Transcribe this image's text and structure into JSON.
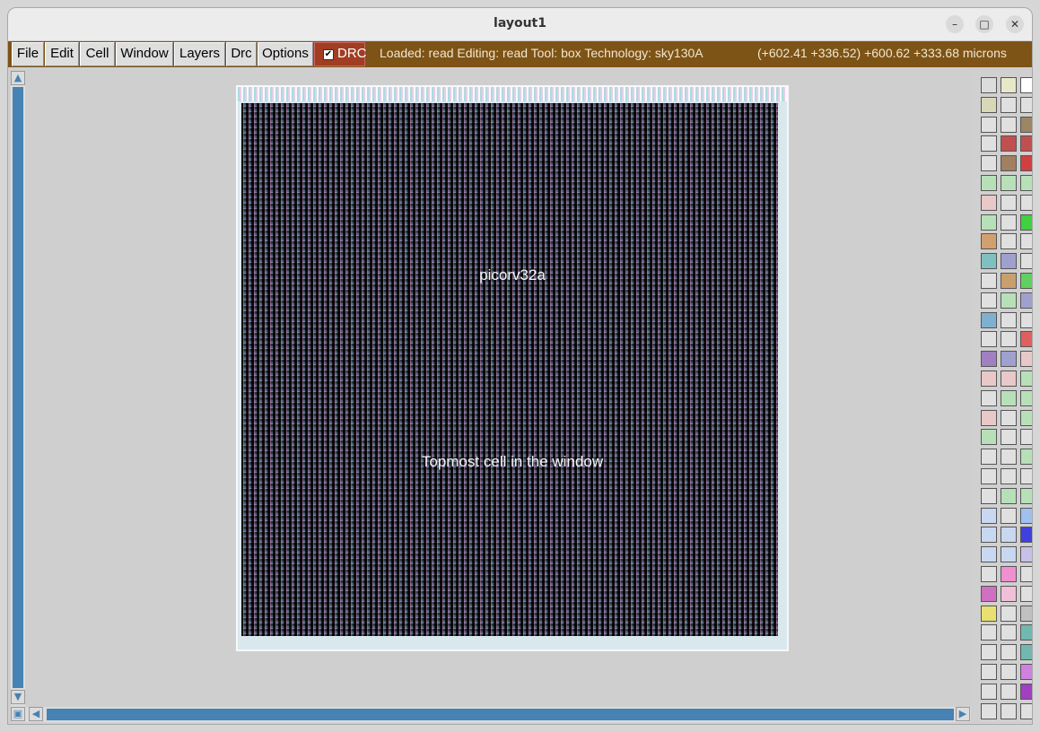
{
  "window": {
    "title": "layout1",
    "minimize": "–",
    "maximize": "□",
    "close": "✕"
  },
  "menu": {
    "items": [
      {
        "id": "file",
        "label": "File"
      },
      {
        "id": "edit",
        "label": "Edit"
      },
      {
        "id": "cell",
        "label": "Cell"
      },
      {
        "id": "window",
        "label": "Window"
      },
      {
        "id": "layers",
        "label": "Layers"
      },
      {
        "id": "drc",
        "label": "Drc"
      },
      {
        "id": "options",
        "label": "Options"
      }
    ],
    "drc_toggle": {
      "label": "DRC",
      "checked": true,
      "check_glyph": "✔"
    }
  },
  "status": {
    "text": "Loaded: read Editing: read Tool: box  Technology: sky130A",
    "coords": "(+602.41 +336.52) +600.62 +333.68 microns"
  },
  "layout": {
    "cell_name": "picorv32a",
    "cell_description": "Topmost cell in the window"
  },
  "scroll": {
    "up": "▲",
    "down": "▼",
    "left": "◀",
    "right": "▶",
    "corner": "▣"
  },
  "palette": {
    "rows": [
      [
        "#dcdcdc",
        "#e8e8c8",
        "#ffffff"
      ],
      [
        "#d8d8b8",
        "#e0e0e0",
        "#e0e0e0"
      ],
      [
        "#e0e0e0",
        "#e0e0e0",
        "#9c8663"
      ],
      [
        "#e0e0e0",
        "#c05050",
        "#c05050"
      ],
      [
        "#e0e0e0",
        "#a08060",
        "#d04040"
      ],
      [
        "#b8e0b8",
        "#b8e0b8",
        "#b8e0b8"
      ],
      [
        "#e8c8c8",
        "#e0e0e0",
        "#e0e0e0"
      ],
      [
        "#b8e0b8",
        "#e0e0e0",
        "#40d040"
      ],
      [
        "#d0a070",
        "#e0e0e0",
        "#e0e0e0"
      ],
      [
        "#80c0c0",
        "#a0a0d0",
        "#e0e0e0"
      ],
      [
        "#e0e0e0",
        "#c8a070",
        "#60d060"
      ],
      [
        "#e0e0e0",
        "#b8e0b8",
        "#a0a0d0"
      ],
      [
        "#80b0d0",
        "#e0e0e0",
        "#e0e0e0"
      ],
      [
        "#e0e0e0",
        "#e0e0e0",
        "#e06060"
      ],
      [
        "#a080c0",
        "#a0a0d0",
        "#e8c8c8"
      ],
      [
        "#e8c8c8",
        "#e8c8c8",
        "#b8e0b8"
      ],
      [
        "#e0e0e0",
        "#b8e0b8",
        "#b8e0b8"
      ],
      [
        "#e8c8c8",
        "#e0e0e0",
        "#b8e0b8"
      ],
      [
        "#b8e0b8",
        "#e0e0e0",
        "#e0e0e0"
      ],
      [
        "#e0e0e0",
        "#e0e0e0",
        "#b8e0b8"
      ],
      [
        "#e0e0e0",
        "#e0e0e0",
        "#e0e0e0"
      ],
      [
        "#e0e0e0",
        "#b8e0b8",
        "#b8e0b8"
      ],
      [
        "#c8d8f0",
        "#e0e0e0",
        "#a0c0f0"
      ],
      [
        "#c8d8f0",
        "#c8d8f0",
        "#4040e0"
      ],
      [
        "#c8d8f0",
        "#c8d8f0",
        "#c8c0e8"
      ],
      [
        "#e0e0e0",
        "#f090d0",
        "#e0e0e0"
      ],
      [
        "#d070c0",
        "#f0c0d8",
        "#e0e0e0"
      ],
      [
        "#e8e070",
        "#e0e0e0",
        "#c0c0c0"
      ],
      [
        "#e0e0e0",
        "#e0e0e0",
        "#70b8b0"
      ],
      [
        "#e0e0e0",
        "#e0e0e0",
        "#70b8b0"
      ],
      [
        "#e0e0e0",
        "#e0e0e0",
        "#d080e0"
      ],
      [
        "#e0e0e0",
        "#e0e0e0",
        "#a040c0"
      ],
      [
        "#e0e0e0",
        "#e0e0e0",
        "#e0e0e0"
      ]
    ],
    "lock_glyph": "🔒"
  }
}
